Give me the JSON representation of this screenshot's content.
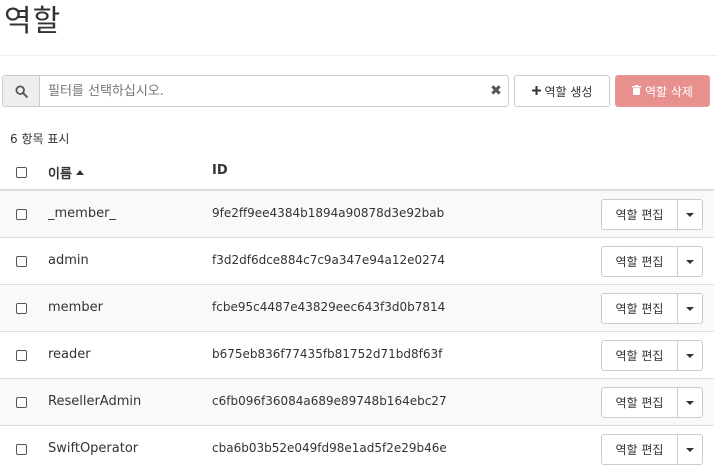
{
  "page": {
    "title": "역할"
  },
  "filter": {
    "placeholder": "필터를 선택하십시오.",
    "search_icon": "search-icon",
    "clear_icon": "close-icon"
  },
  "toolbar": {
    "create_label": "역할 생성",
    "create_icon": "plus-icon",
    "delete_label": "역할 삭제",
    "delete_icon": "trash-icon",
    "delete_color": "#e8908e"
  },
  "count_text": "6 항목 표시",
  "table": {
    "columns": {
      "name": "이름",
      "id": "ID"
    },
    "sort": {
      "column": "name",
      "direction": "asc"
    },
    "rows": [
      {
        "name": "_member_",
        "id": "9fe2ff9ee4384b1894a90878d3e92bab",
        "action": "역할 편집"
      },
      {
        "name": "admin",
        "id": "f3d2df6dce884c7c9a347e94a12e0274",
        "action": "역할 편집"
      },
      {
        "name": "member",
        "id": "fcbe95c4487e43829eec643f3d0b7814",
        "action": "역할 편집"
      },
      {
        "name": "reader",
        "id": "b675eb836f77435fb81752d71bd8f63f",
        "action": "역할 편집"
      },
      {
        "name": "ResellerAdmin",
        "id": "c6fb096f36084a689e89748b164ebc27",
        "action": "역할 편집"
      },
      {
        "name": "SwiftOperator",
        "id": "cba6b03b52e049fd98e1ad5f2e29b46e",
        "action": "역할 편집"
      }
    ]
  }
}
